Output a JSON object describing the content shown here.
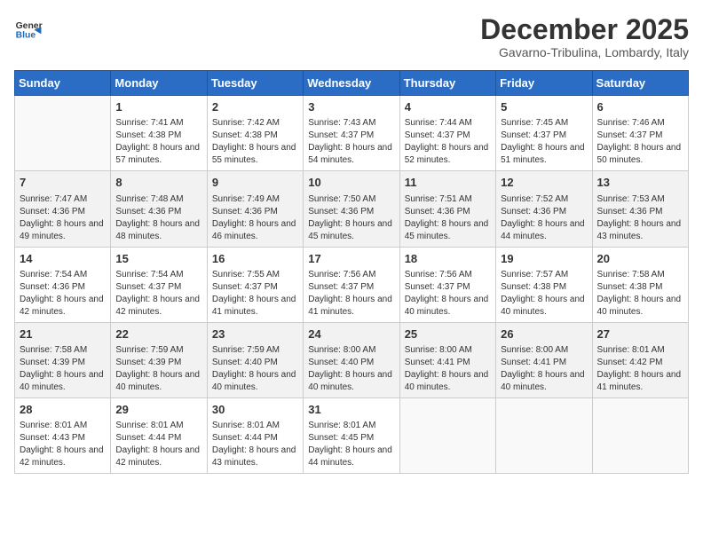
{
  "header": {
    "logo_general": "General",
    "logo_blue": "Blue",
    "title": "December 2025",
    "subtitle": "Gavarno-Tribulina, Lombardy, Italy"
  },
  "days_of_week": [
    "Sunday",
    "Monday",
    "Tuesday",
    "Wednesday",
    "Thursday",
    "Friday",
    "Saturday"
  ],
  "weeks": [
    [
      {
        "day": "",
        "sunrise": "",
        "sunset": "",
        "daylight": "",
        "empty": true
      },
      {
        "day": "1",
        "sunrise": "Sunrise: 7:41 AM",
        "sunset": "Sunset: 4:38 PM",
        "daylight": "Daylight: 8 hours and 57 minutes."
      },
      {
        "day": "2",
        "sunrise": "Sunrise: 7:42 AM",
        "sunset": "Sunset: 4:38 PM",
        "daylight": "Daylight: 8 hours and 55 minutes."
      },
      {
        "day": "3",
        "sunrise": "Sunrise: 7:43 AM",
        "sunset": "Sunset: 4:37 PM",
        "daylight": "Daylight: 8 hours and 54 minutes."
      },
      {
        "day": "4",
        "sunrise": "Sunrise: 7:44 AM",
        "sunset": "Sunset: 4:37 PM",
        "daylight": "Daylight: 8 hours and 52 minutes."
      },
      {
        "day": "5",
        "sunrise": "Sunrise: 7:45 AM",
        "sunset": "Sunset: 4:37 PM",
        "daylight": "Daylight: 8 hours and 51 minutes."
      },
      {
        "day": "6",
        "sunrise": "Sunrise: 7:46 AM",
        "sunset": "Sunset: 4:37 PM",
        "daylight": "Daylight: 8 hours and 50 minutes."
      }
    ],
    [
      {
        "day": "7",
        "sunrise": "Sunrise: 7:47 AM",
        "sunset": "Sunset: 4:36 PM",
        "daylight": "Daylight: 8 hours and 49 minutes."
      },
      {
        "day": "8",
        "sunrise": "Sunrise: 7:48 AM",
        "sunset": "Sunset: 4:36 PM",
        "daylight": "Daylight: 8 hours and 48 minutes."
      },
      {
        "day": "9",
        "sunrise": "Sunrise: 7:49 AM",
        "sunset": "Sunset: 4:36 PM",
        "daylight": "Daylight: 8 hours and 46 minutes."
      },
      {
        "day": "10",
        "sunrise": "Sunrise: 7:50 AM",
        "sunset": "Sunset: 4:36 PM",
        "daylight": "Daylight: 8 hours and 45 minutes."
      },
      {
        "day": "11",
        "sunrise": "Sunrise: 7:51 AM",
        "sunset": "Sunset: 4:36 PM",
        "daylight": "Daylight: 8 hours and 45 minutes."
      },
      {
        "day": "12",
        "sunrise": "Sunrise: 7:52 AM",
        "sunset": "Sunset: 4:36 PM",
        "daylight": "Daylight: 8 hours and 44 minutes."
      },
      {
        "day": "13",
        "sunrise": "Sunrise: 7:53 AM",
        "sunset": "Sunset: 4:36 PM",
        "daylight": "Daylight: 8 hours and 43 minutes."
      }
    ],
    [
      {
        "day": "14",
        "sunrise": "Sunrise: 7:54 AM",
        "sunset": "Sunset: 4:36 PM",
        "daylight": "Daylight: 8 hours and 42 minutes."
      },
      {
        "day": "15",
        "sunrise": "Sunrise: 7:54 AM",
        "sunset": "Sunset: 4:37 PM",
        "daylight": "Daylight: 8 hours and 42 minutes."
      },
      {
        "day": "16",
        "sunrise": "Sunrise: 7:55 AM",
        "sunset": "Sunset: 4:37 PM",
        "daylight": "Daylight: 8 hours and 41 minutes."
      },
      {
        "day": "17",
        "sunrise": "Sunrise: 7:56 AM",
        "sunset": "Sunset: 4:37 PM",
        "daylight": "Daylight: 8 hours and 41 minutes."
      },
      {
        "day": "18",
        "sunrise": "Sunrise: 7:56 AM",
        "sunset": "Sunset: 4:37 PM",
        "daylight": "Daylight: 8 hours and 40 minutes."
      },
      {
        "day": "19",
        "sunrise": "Sunrise: 7:57 AM",
        "sunset": "Sunset: 4:38 PM",
        "daylight": "Daylight: 8 hours and 40 minutes."
      },
      {
        "day": "20",
        "sunrise": "Sunrise: 7:58 AM",
        "sunset": "Sunset: 4:38 PM",
        "daylight": "Daylight: 8 hours and 40 minutes."
      }
    ],
    [
      {
        "day": "21",
        "sunrise": "Sunrise: 7:58 AM",
        "sunset": "Sunset: 4:39 PM",
        "daylight": "Daylight: 8 hours and 40 minutes."
      },
      {
        "day": "22",
        "sunrise": "Sunrise: 7:59 AM",
        "sunset": "Sunset: 4:39 PM",
        "daylight": "Daylight: 8 hours and 40 minutes."
      },
      {
        "day": "23",
        "sunrise": "Sunrise: 7:59 AM",
        "sunset": "Sunset: 4:40 PM",
        "daylight": "Daylight: 8 hours and 40 minutes."
      },
      {
        "day": "24",
        "sunrise": "Sunrise: 8:00 AM",
        "sunset": "Sunset: 4:40 PM",
        "daylight": "Daylight: 8 hours and 40 minutes."
      },
      {
        "day": "25",
        "sunrise": "Sunrise: 8:00 AM",
        "sunset": "Sunset: 4:41 PM",
        "daylight": "Daylight: 8 hours and 40 minutes."
      },
      {
        "day": "26",
        "sunrise": "Sunrise: 8:00 AM",
        "sunset": "Sunset: 4:41 PM",
        "daylight": "Daylight: 8 hours and 40 minutes."
      },
      {
        "day": "27",
        "sunrise": "Sunrise: 8:01 AM",
        "sunset": "Sunset: 4:42 PM",
        "daylight": "Daylight: 8 hours and 41 minutes."
      }
    ],
    [
      {
        "day": "28",
        "sunrise": "Sunrise: 8:01 AM",
        "sunset": "Sunset: 4:43 PM",
        "daylight": "Daylight: 8 hours and 42 minutes."
      },
      {
        "day": "29",
        "sunrise": "Sunrise: 8:01 AM",
        "sunset": "Sunset: 4:44 PM",
        "daylight": "Daylight: 8 hours and 42 minutes."
      },
      {
        "day": "30",
        "sunrise": "Sunrise: 8:01 AM",
        "sunset": "Sunset: 4:44 PM",
        "daylight": "Daylight: 8 hours and 43 minutes."
      },
      {
        "day": "31",
        "sunrise": "Sunrise: 8:01 AM",
        "sunset": "Sunset: 4:45 PM",
        "daylight": "Daylight: 8 hours and 44 minutes."
      },
      {
        "day": "",
        "sunrise": "",
        "sunset": "",
        "daylight": "",
        "empty": true
      },
      {
        "day": "",
        "sunrise": "",
        "sunset": "",
        "daylight": "",
        "empty": true
      },
      {
        "day": "",
        "sunrise": "",
        "sunset": "",
        "daylight": "",
        "empty": true
      }
    ]
  ]
}
